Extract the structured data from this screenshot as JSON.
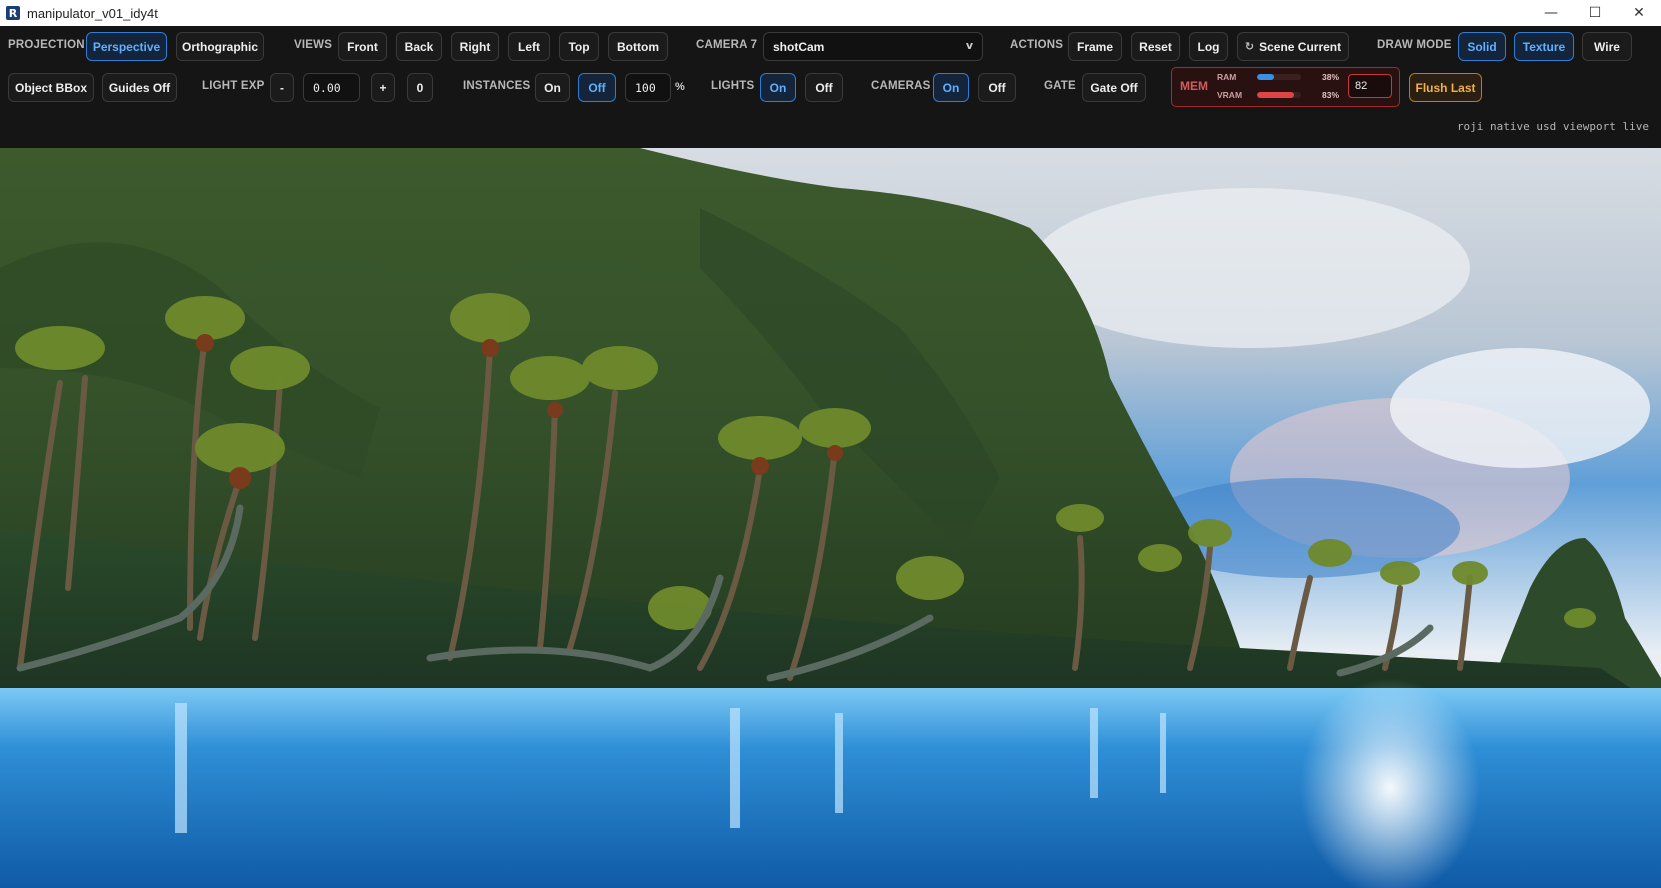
{
  "window": {
    "title": "manipulator_v01_idy4t",
    "app_icon": "R",
    "controls": {
      "minimize": "—",
      "maximize": "☐",
      "close": "✕"
    }
  },
  "toolbar": {
    "projection": {
      "label": "PROJECTION",
      "perspective": "Perspective",
      "orthographic": "Orthographic"
    },
    "views": {
      "label": "VIEWS",
      "front": "Front",
      "back": "Back",
      "right": "Right",
      "left": "Left",
      "top": "Top",
      "bottom": "Bottom"
    },
    "camera": {
      "label": "CAMERA 7",
      "selected": "shotCam",
      "chevron": "v"
    },
    "actions": {
      "label": "ACTIONS",
      "frame": "Frame",
      "reset": "Reset",
      "log": "Log",
      "scene_current": "Scene Current"
    },
    "draw_mode": {
      "label": "DRAW MODE",
      "solid": "Solid",
      "texture": "Texture",
      "wire": "Wire"
    },
    "object_bbox": "Object BBox",
    "guides": "Guides Off",
    "light_exp": {
      "label": "LIGHT EXP",
      "minus": "-",
      "value": "0.00",
      "plus": "+",
      "reset": "0"
    },
    "instances": {
      "label": "INSTANCES",
      "on": "On",
      "off": "Off",
      "value": "100",
      "unit": "%"
    },
    "lights": {
      "label": "LIGHTS",
      "on": "On",
      "off": "Off"
    },
    "cameras": {
      "label": "CAMERAS",
      "on": "On",
      "off": "Off"
    },
    "gate": {
      "label": "GATE",
      "value": "Gate Off"
    },
    "mem": {
      "label": "MEM",
      "ram_label": "RAM",
      "ram_pct_text": "38%",
      "ram_fraction": 0.38,
      "vram_label": "VRAM",
      "vram_pct_text": "83%",
      "vram_fraction": 0.83,
      "threshold": "82",
      "ram_color": "#3b8fe0",
      "vram_color": "#e04545"
    },
    "flush_last": "Flush Last",
    "status": "roji native usd viewport live"
  },
  "colors": {
    "accent": "#2e7ed6",
    "warning": "#f0b050",
    "danger": "#d25d5d"
  }
}
